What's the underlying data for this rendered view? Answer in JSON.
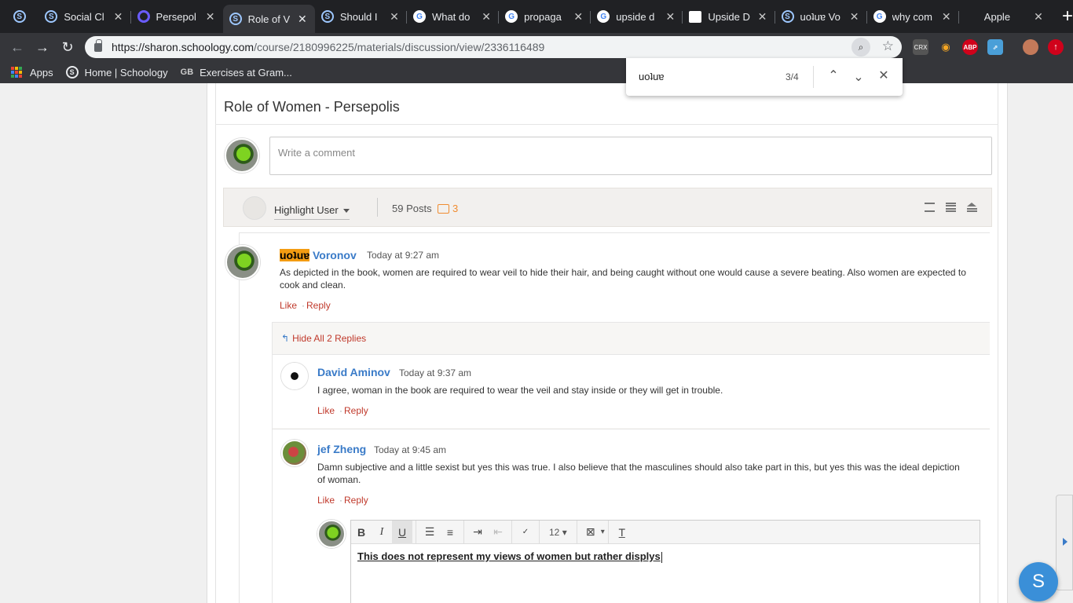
{
  "tabs": [
    {
      "title": "",
      "icon": "schoology-icon",
      "active": false
    },
    {
      "title": "Social Cl",
      "icon": "schoology-icon",
      "active": false
    },
    {
      "title": "Persepol",
      "icon": "q-icon",
      "active": false
    },
    {
      "title": "Role of V",
      "icon": "schoology-icon",
      "active": true
    },
    {
      "title": "Should I",
      "icon": "schoology-icon",
      "active": false
    },
    {
      "title": "What do",
      "icon": "google-icon",
      "active": false
    },
    {
      "title": "propaga",
      "icon": "google-icon",
      "active": false
    },
    {
      "title": "upside d",
      "icon": "google-icon",
      "active": false
    },
    {
      "title": "Upside D",
      "icon": "doc-icon",
      "active": false
    },
    {
      "title": "uoʇuɐ Vo",
      "icon": "schoology-icon",
      "active": false
    },
    {
      "title": "why com",
      "icon": "google-icon",
      "active": false
    },
    {
      "title": "Apple",
      "icon": "apple-icon",
      "active": false
    }
  ],
  "toolbar": {
    "url_domain": "https://sharon.schoology.com",
    "url_path": "/course/2180996225/materials/discussion/view/2336116489",
    "extensions": [
      "CRX",
      "ABP"
    ]
  },
  "bookmarks": {
    "apps": "Apps",
    "home": "Home | Schoology",
    "gb_badge": "GB",
    "exercises": "Exercises at Gram..."
  },
  "find": {
    "query": "uoʇuɐ",
    "count": "3/4"
  },
  "page": {
    "title": "Role of Women - Persepolis",
    "comment_placeholder": "Write a comment",
    "highlight_user": "Highlight User",
    "posts": "59 Posts",
    "new_count": "3"
  },
  "posts": [
    {
      "first_name": "uoʇuɐ",
      "last_name": " Voronov",
      "time": "Today at 9:27 am",
      "body": "As depicted in the book, women are required to wear veil to hide their hair, and being caught without one would cause a severe beating. Also women are expected to cook and clean.",
      "like": "Like",
      "reply": "Reply"
    }
  ],
  "hide_replies": "Hide All 2 Replies",
  "replies": [
    {
      "name": "David Aminov",
      "time": "Today at 9:37 am",
      "body": "I agree, woman in the book are required to wear the veil and stay inside or they will get in trouble.",
      "like": "Like",
      "reply": "Reply"
    },
    {
      "name": "jef Zheng",
      "time": "Today at 9:45 am",
      "body": "Damn subjective and a little sexist but yes this was true. I also believe that the masculines should also take part in this, but yes this was the ideal depiction of woman.",
      "like": "Like",
      "reply": "Reply"
    }
  ],
  "editor": {
    "bold": "B",
    "italic": "I",
    "underline": "U",
    "font_size": "12",
    "text": "This does not represent my views of women but rather displys"
  },
  "fab": "S"
}
